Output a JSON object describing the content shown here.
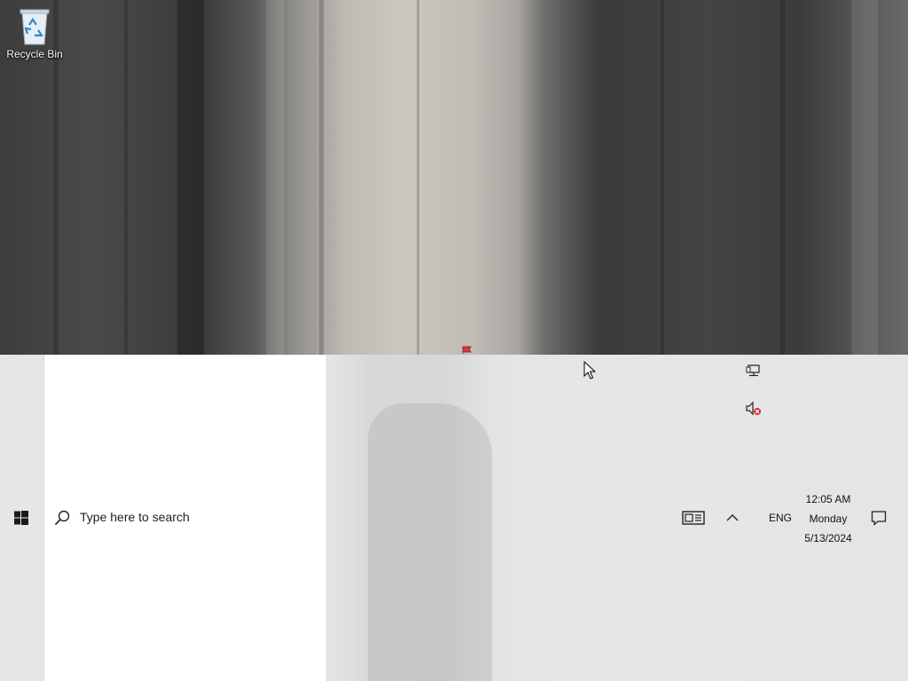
{
  "desktop": {
    "icons": [
      {
        "label": "Recycle Bin",
        "icon": "recycle-bin-icon"
      }
    ]
  },
  "taskbar": {
    "start": {
      "icon": "windows-logo-icon"
    },
    "search": {
      "placeholder": "Type here to search",
      "icon": "search-icon"
    },
    "tray": {
      "news_icon": "news-and-interests-icon",
      "overflow_icon": "chevron-up-icon",
      "language": "ENG",
      "network_icon": "network-icon",
      "volume_icon": "volume-muted-icon",
      "clock": {
        "time": "12:05 AM",
        "day": "Monday",
        "date": "5/13/2024"
      },
      "notification_icon": "notification-icon"
    }
  }
}
